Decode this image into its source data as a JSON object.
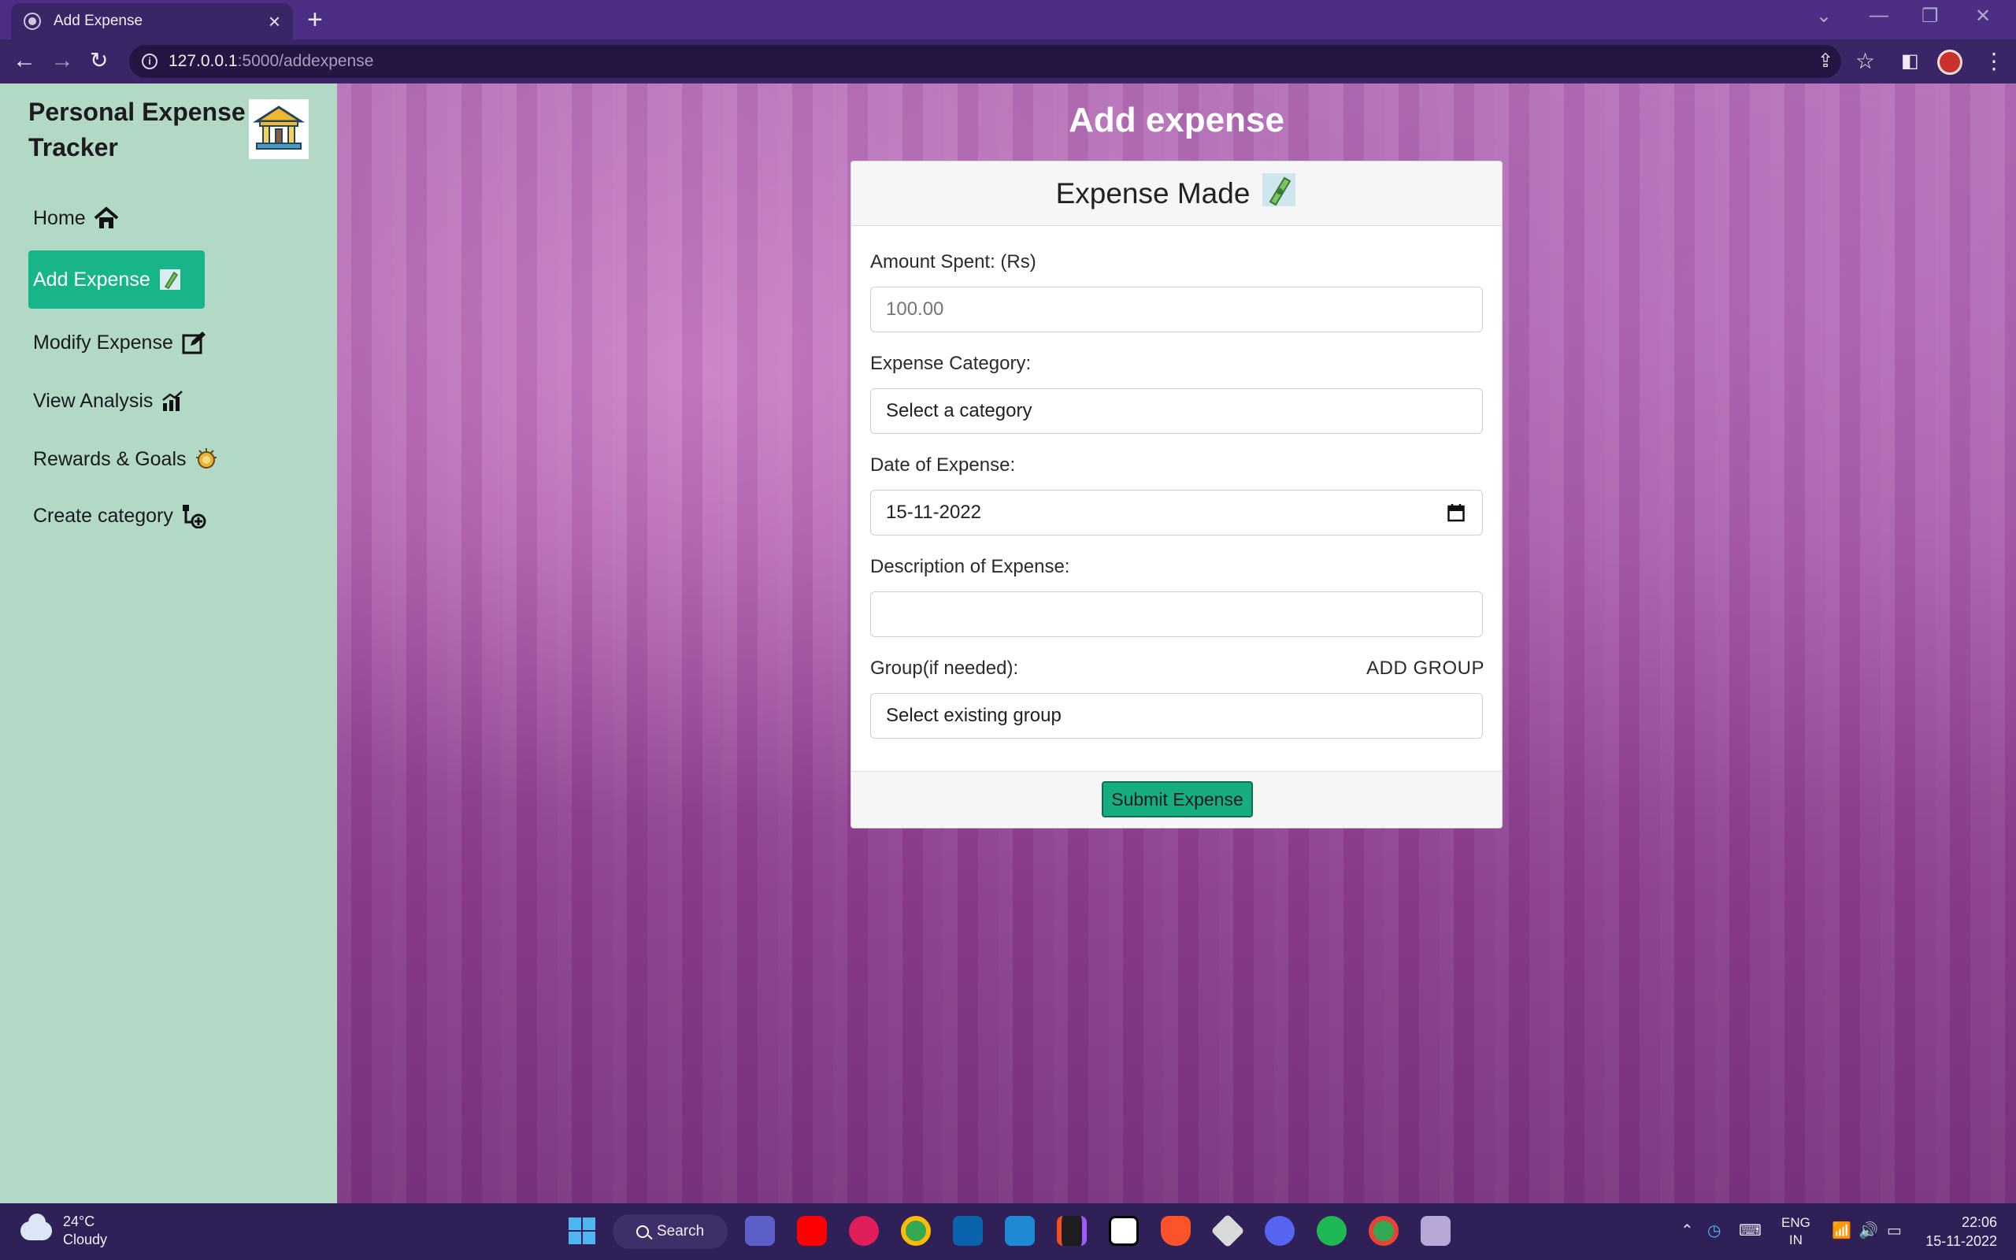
{
  "browser": {
    "tab_title": "Add Expense",
    "tab_close": "×",
    "new_tab": "+",
    "url_host": "127.0.0.1",
    "url_path": ":5000/addexpense",
    "info": "i"
  },
  "sidebar": {
    "brand": "Personal Expense Tracker",
    "items": [
      {
        "label": "Home",
        "icon": "home-icon",
        "active": false
      },
      {
        "label": "Add Expense",
        "icon": "cash-icon",
        "active": true
      },
      {
        "label": "Modify Expense",
        "icon": "edit-icon",
        "active": false
      },
      {
        "label": "View Analysis",
        "icon": "chart-icon",
        "active": false
      },
      {
        "label": "Rewards & Goals",
        "icon": "medal-icon",
        "active": false
      },
      {
        "label": "Create category",
        "icon": "category-add-icon",
        "active": false
      }
    ]
  },
  "main": {
    "title": "Add expense",
    "card": {
      "header": "Expense Made",
      "amount_label": "Amount Spent: (Rs)",
      "amount_placeholder": "100.00",
      "category_label": "Expense Category:",
      "category_value": "Select a category",
      "date_label": "Date of Expense:",
      "date_value": "15-11-2022",
      "description_label": "Description of Expense:",
      "description_value": "",
      "group_label": "Group(if needed):",
      "add_group": "ADD GROUP",
      "group_value": "Select existing group",
      "submit": "Submit Expense"
    }
  },
  "taskbar": {
    "temperature": "24°C",
    "weather": "Cloudy",
    "search": "Search",
    "lang_top": "ENG",
    "lang_bottom": "IN",
    "time": "22:06",
    "date": "15-11-2022"
  },
  "colors": {
    "sidebar_bg": "#b2d8c6",
    "accent": "#17b588",
    "browser_frame": "#4c2e84",
    "taskbar": "#2f2157"
  }
}
